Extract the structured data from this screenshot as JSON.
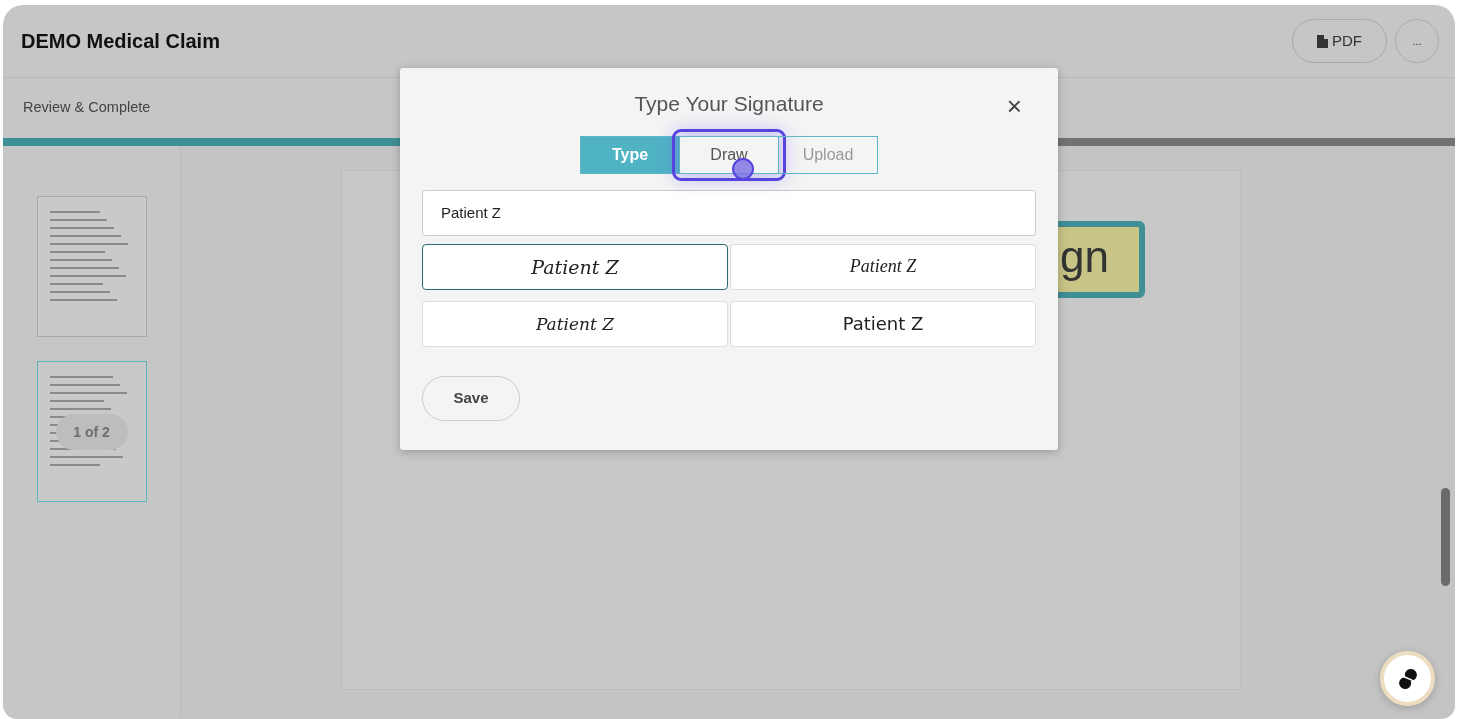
{
  "header": {
    "title": "DEMO Medical Claim",
    "pdf_button": "PDF",
    "more_button": "..."
  },
  "step": {
    "label": "Review & Complete",
    "level": 0.3
  },
  "thumbnails": [
    {
      "selected": false
    },
    {
      "selected": true
    }
  ],
  "page_counter": "1 of 2",
  "sign_tag": {
    "label": "gn"
  },
  "dialog": {
    "title": "Type Your Signature",
    "close": "×",
    "tabs": [
      {
        "label": "Type",
        "selected": true,
        "highlighted": false
      },
      {
        "label": "Draw",
        "selected": false,
        "highlighted": true
      },
      {
        "label": "Upload",
        "selected": false,
        "highlighted": false
      }
    ],
    "name_field": {
      "value": "Patient Z"
    },
    "options": [
      {
        "text": "Patient Z",
        "selected": true
      },
      {
        "text": "Patient Z",
        "selected": false
      },
      {
        "text": "Patient Z",
        "selected": false
      },
      {
        "text": "Patient Z",
        "selected": false
      }
    ],
    "save_button": "Save"
  }
}
